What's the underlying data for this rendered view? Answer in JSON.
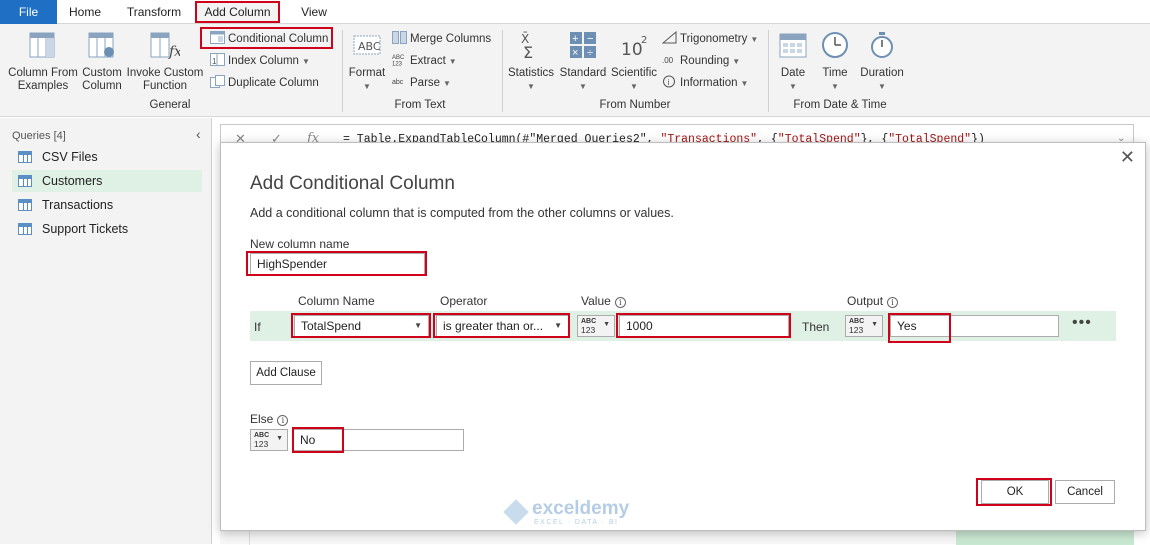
{
  "tabs": [
    {
      "label": "File"
    },
    {
      "label": "Home"
    },
    {
      "label": "Transform"
    },
    {
      "label": "Add Column"
    },
    {
      "label": "View"
    }
  ],
  "ribbon": {
    "general": {
      "group_label": "General",
      "column_from_examples": "Column From Examples",
      "custom_column": "Custom Column",
      "invoke_custom_function": "Invoke Custom Function",
      "conditional_column": "Conditional Column",
      "index_column": "Index Column",
      "duplicate_column": "Duplicate Column"
    },
    "from_text": {
      "group_label": "From Text",
      "format": "Format",
      "merge_columns": "Merge Columns",
      "extract": "Extract",
      "parse": "Parse"
    },
    "from_number": {
      "group_label": "From Number",
      "statistics": "Statistics",
      "standard": "Standard",
      "scientific": "Scientific",
      "trigonometry": "Trigonometry",
      "rounding": "Rounding",
      "information": "Information"
    },
    "from_date_time": {
      "group_label": "From Date & Time",
      "date": "Date",
      "time": "Time",
      "duration": "Duration"
    }
  },
  "queries": {
    "header": "Queries [4]",
    "items": [
      {
        "label": "CSV Files",
        "selected": false
      },
      {
        "label": "Customers",
        "selected": true
      },
      {
        "label": "Transactions",
        "selected": false
      },
      {
        "label": "Support Tickets",
        "selected": false
      }
    ]
  },
  "formula_bar": {
    "fx": "fx",
    "formula_prefix": "= Table.ExpandTableColumn(#\"Merged Queries2\", ",
    "formula_str1": "\"Transactions\"",
    "formula_mid": ", {",
    "formula_str2": "\"TotalSpend\"",
    "formula_mid2": "}, {",
    "formula_str3": "\"TotalSpend\"",
    "formula_suffix": "})"
  },
  "dialog": {
    "title": "Add Conditional Column",
    "description": "Add a conditional column that is computed from the other columns or values.",
    "new_column_label": "New column name",
    "new_column_value": "HighSpender",
    "headers": {
      "column_name": "Column Name",
      "operator": "Operator",
      "value": "Value",
      "output": "Output"
    },
    "clause": {
      "if_label": "If",
      "column_name": "TotalSpend",
      "operator": "is greater than or...",
      "value_type_abc": "ABC",
      "value_type_123": "123",
      "value": "1000",
      "then_label": "Then",
      "output": "Yes"
    },
    "add_clause": "Add Clause",
    "else_label": "Else",
    "else_value": "No",
    "ok": "OK",
    "cancel": "Cancel"
  },
  "watermark": {
    "name": "exceldemy",
    "sub": "EXCEL · DATA · BI"
  },
  "colors": {
    "accent": "#1f6fc5",
    "highlight": "#d0021b",
    "selection": "#dff0e4"
  }
}
